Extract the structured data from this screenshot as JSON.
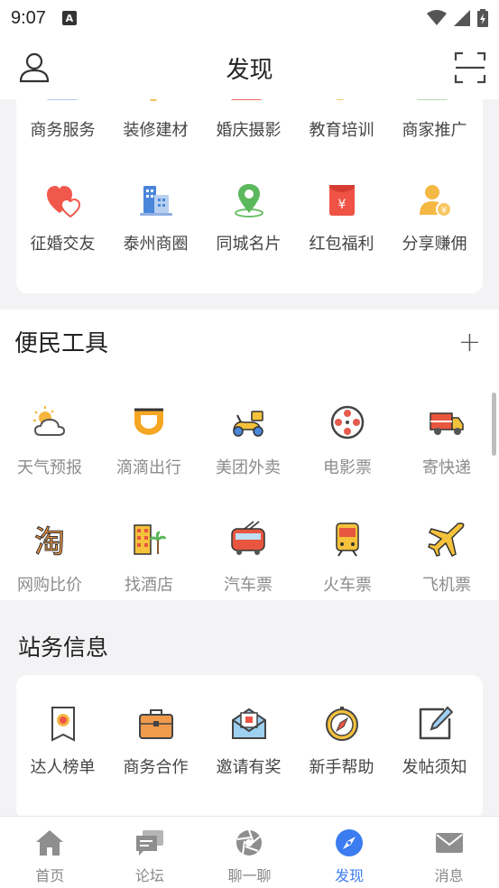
{
  "status": {
    "time": "9:07",
    "a_badge": "A"
  },
  "header": {
    "title": "发现"
  },
  "services": {
    "row1": [
      {
        "label": "商务服务",
        "icon": "business-icon"
      },
      {
        "label": "装修建材",
        "icon": "renovation-icon"
      },
      {
        "label": "婚庆摄影",
        "icon": "wedding-photo-icon"
      },
      {
        "label": "教育培训",
        "icon": "education-icon"
      },
      {
        "label": "商家推广",
        "icon": "promotion-icon"
      }
    ],
    "row2": [
      {
        "label": "征婚交友",
        "icon": "hearts-icon"
      },
      {
        "label": "泰州商圈",
        "icon": "buildings-icon"
      },
      {
        "label": "同城名片",
        "icon": "location-pin-icon"
      },
      {
        "label": "红包福利",
        "icon": "red-envelope-icon"
      },
      {
        "label": "分享赚佣",
        "icon": "share-earn-icon"
      }
    ]
  },
  "tools": {
    "title": "便民工具",
    "add_label": "+",
    "row1": [
      {
        "label": "天气预报",
        "icon": "weather-icon"
      },
      {
        "label": "滴滴出行",
        "icon": "didi-icon"
      },
      {
        "label": "美团外卖",
        "icon": "scooter-icon"
      },
      {
        "label": "电影票",
        "icon": "film-reel-icon"
      },
      {
        "label": "寄快递",
        "icon": "truck-icon"
      }
    ],
    "row2": [
      {
        "label": "网购比价",
        "icon": "taobao-icon"
      },
      {
        "label": "找酒店",
        "icon": "hotel-icon"
      },
      {
        "label": "汽车票",
        "icon": "bus-icon"
      },
      {
        "label": "火车票",
        "icon": "train-icon"
      },
      {
        "label": "飞机票",
        "icon": "airplane-icon"
      }
    ]
  },
  "station": {
    "title": "站务信息",
    "items": [
      {
        "label": "达人榜单",
        "icon": "ribbon-award-icon"
      },
      {
        "label": "商务合作",
        "icon": "briefcase-icon"
      },
      {
        "label": "邀请有奖",
        "icon": "invite-envelope-icon"
      },
      {
        "label": "新手帮助",
        "icon": "compass-icon"
      },
      {
        "label": "发帖须知",
        "icon": "edit-icon"
      }
    ]
  },
  "tabs": [
    {
      "label": "首页",
      "icon": "home-icon"
    },
    {
      "label": "论坛",
      "icon": "chat-icon"
    },
    {
      "label": "聊一聊",
      "icon": "aperture-icon"
    },
    {
      "label": "发现",
      "icon": "compass-icon",
      "active": true
    },
    {
      "label": "消息",
      "icon": "mail-icon"
    }
  ],
  "colors": {
    "accent": "#3b7cf0",
    "tool_label": "#8c8c8c"
  }
}
